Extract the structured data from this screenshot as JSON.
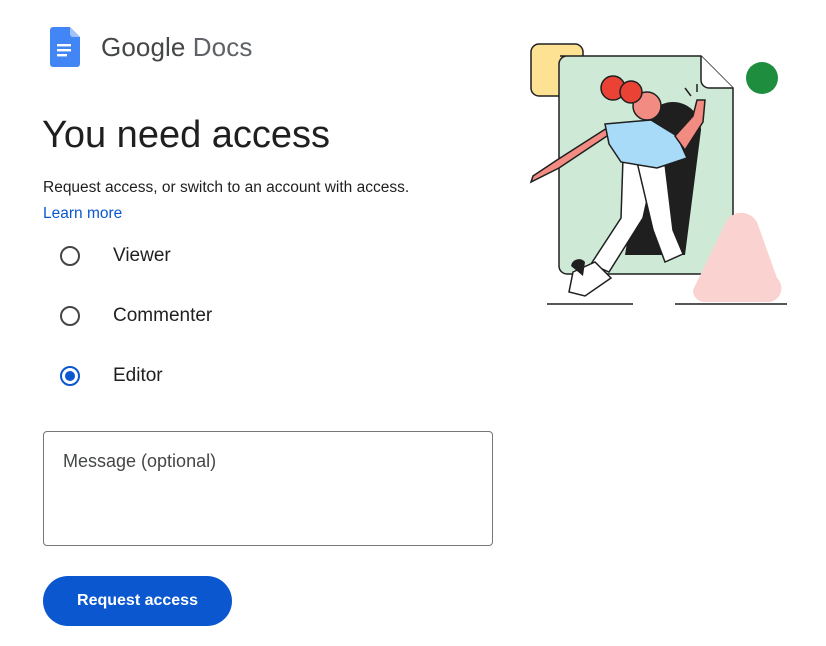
{
  "brand": {
    "name_part1": "Google",
    "name_part2": "Docs",
    "logo_icon": "google-docs-icon",
    "logo_color": "#4285f4"
  },
  "main": {
    "title": "You need access",
    "description": "Request access, or switch to an account with access.",
    "learn_more": "Learn more"
  },
  "roles": {
    "options": [
      {
        "label": "Viewer",
        "checked": false
      },
      {
        "label": "Commenter",
        "checked": false
      },
      {
        "label": "Editor",
        "checked": true
      }
    ]
  },
  "message": {
    "placeholder": "Message (optional)",
    "value": ""
  },
  "actions": {
    "request_label": "Request access"
  },
  "colors": {
    "accent": "#0b57d0",
    "illustration_green": "#ceead6",
    "illustration_yellow": "#fde293",
    "illustration_pink": "#fad2cf",
    "illustration_red": "#ea4335",
    "illustration_dot": "#1e8e3e"
  },
  "illustration": {
    "icon": "person-walking-into-document-illustration"
  }
}
